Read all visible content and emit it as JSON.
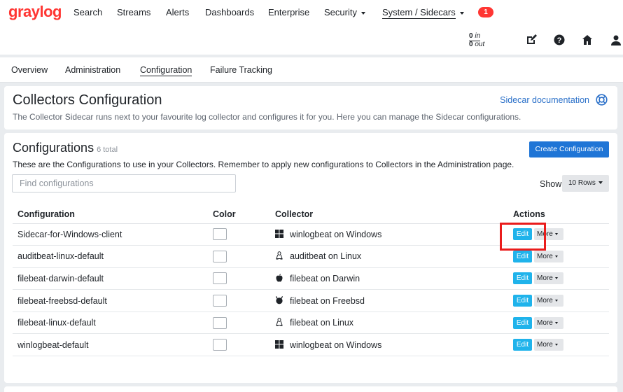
{
  "brand": {
    "logo_text": "graylog",
    "logo_color": "#ff3633"
  },
  "nav": {
    "search": "Search",
    "streams": "Streams",
    "alerts": "Alerts",
    "dashboards": "Dashboards",
    "enterprise": "Enterprise",
    "security": "Security",
    "system": "System / Sidecars",
    "notification_count": "1"
  },
  "throughput": {
    "in_value": "0",
    "in_label": "in",
    "out_value": "0",
    "out_label": "out"
  },
  "subnav": {
    "overview": "Overview",
    "administration": "Administration",
    "configuration": "Configuration",
    "failure_tracking": "Failure Tracking"
  },
  "header_panel": {
    "title": "Collectors Configuration",
    "description": "The Collector Sidecar runs next to your favourite log collector and configures it for you. Here you can manage the Sidecar configurations.",
    "doc_link": "Sidecar documentation"
  },
  "config_panel": {
    "title": "Configurations",
    "count": "6 total",
    "description": "These are the Configurations to use in your Collectors. Remember to apply new configurations to Collectors in the Administration page.",
    "create_button": "Create Configuration",
    "search_placeholder": "Find configurations",
    "show_label": "Show",
    "rows_option": "10 Rows",
    "columns": {
      "configuration": "Configuration",
      "color": "Color",
      "collector": "Collector",
      "actions": "Actions"
    },
    "edit_label": "Edit",
    "more_label": "More",
    "rows": [
      {
        "name": "Sidecar-for-Windows-client",
        "collector": "winlogbeat on Windows",
        "os_icon": "windows-icon"
      },
      {
        "name": "auditbeat-linux-default",
        "collector": "auditbeat on Linux",
        "os_icon": "linux-icon"
      },
      {
        "name": "filebeat-darwin-default",
        "collector": "filebeat on Darwin",
        "os_icon": "apple-icon"
      },
      {
        "name": "filebeat-freebsd-default",
        "collector": "filebeat on Freebsd",
        "os_icon": "freebsd-icon"
      },
      {
        "name": "filebeat-linux-default",
        "collector": "filebeat on Linux",
        "os_icon": "linux-icon"
      },
      {
        "name": "winlogbeat-default",
        "collector": "winlogbeat on Windows",
        "os_icon": "windows-icon"
      }
    ]
  },
  "colors": {
    "accent": "#1f75d6",
    "edit": "#1fb3eb",
    "link": "#2c71c9",
    "highlight": "#ea1c1c"
  }
}
